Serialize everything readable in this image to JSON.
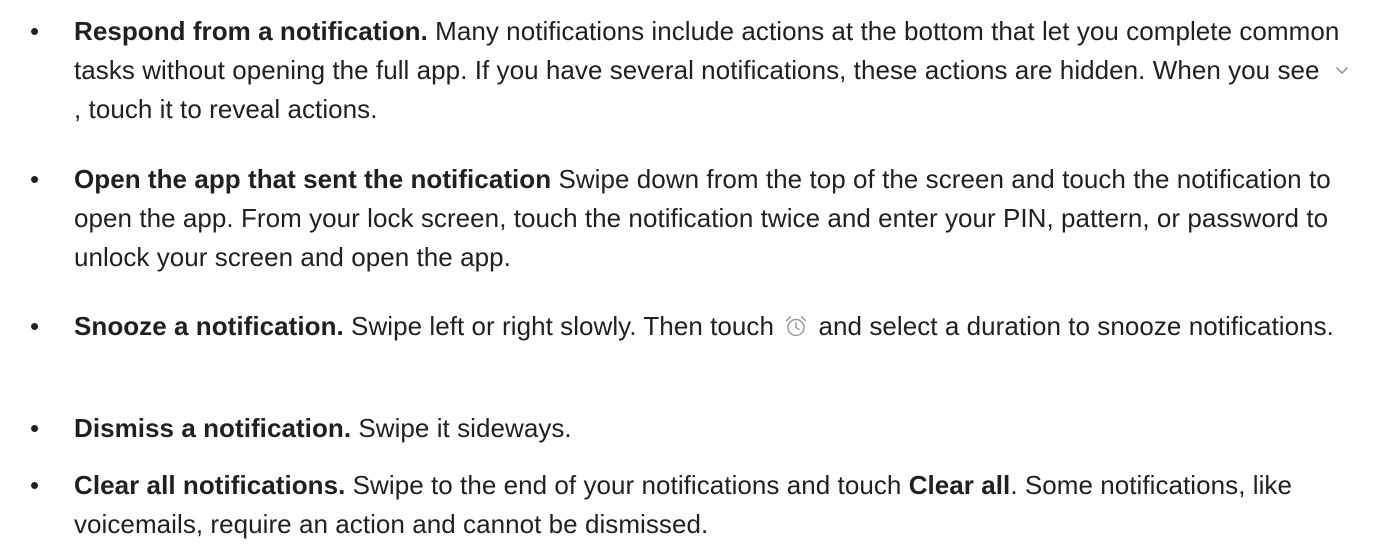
{
  "items": [
    {
      "title": "Respond from a notification.",
      "text_before_icon": " Many notifications include actions at the bottom that let you complete common tasks without opening the full app. If you have several notifications, these actions are hidden. When you see ",
      "icon": "chevron-down-icon",
      "text_after_icon": ", touch it to reveal actions."
    },
    {
      "title": "Open the app that sent the notification",
      "text": " Swipe down from the top of the screen and touch the notification to open the app. From your lock screen, touch the notification twice and enter your PIN, pattern, or password to unlock your screen and open the app."
    },
    {
      "title": "Snooze a notification.",
      "text_before_icon": " Swipe left or right slowly. Then touch ",
      "icon": "alarm-clock-icon",
      "text_after_icon": " and select a duration to snooze notifications."
    },
    {
      "title": "Dismiss a notification.",
      "text": " Swipe it sideways."
    },
    {
      "title": "Clear all notifications.",
      "text_before_bold": " Swipe to the end of your notifications and touch ",
      "bold": "Clear all",
      "text_after_bold": ". Some notifications, like voicemails, require an action and cannot be dismissed."
    }
  ],
  "bullet": "•",
  "colors": {
    "text": "#231f20",
    "icon": "#9b9b9b"
  }
}
